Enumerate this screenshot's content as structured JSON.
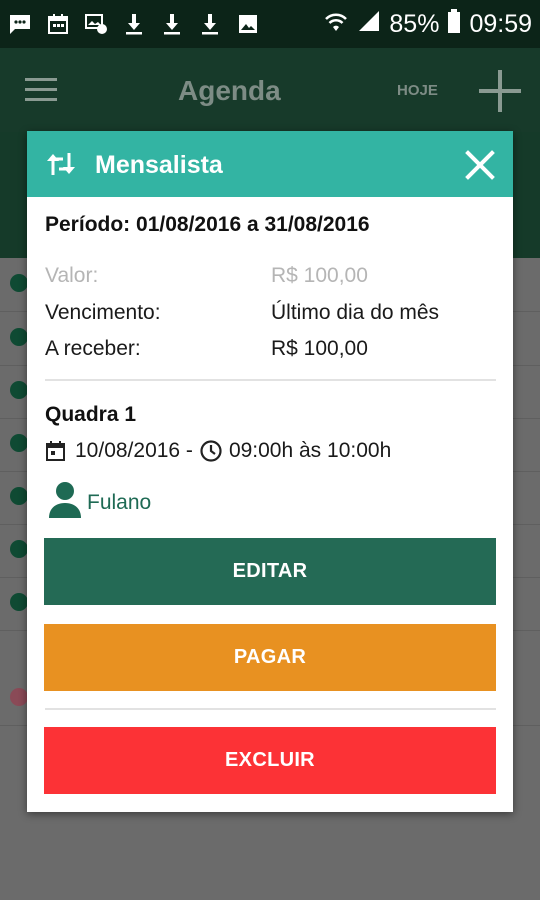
{
  "status_bar": {
    "battery": "85%",
    "time": "09:59",
    "left_icons": [
      "message-icon",
      "calendar-icon",
      "screenshot-icon",
      "download-icon",
      "download-icon",
      "download-icon",
      "image-icon"
    ]
  },
  "app_bar": {
    "title": "Agenda",
    "today_label": "HOJE"
  },
  "dialog": {
    "title": "Mensalista",
    "period_label": "Período:",
    "period_value": "01/08/2016 a 31/08/2016",
    "valor_label": "Valor:",
    "valor_value": "R$ 100,00",
    "vencimento_label": "Vencimento:",
    "vencimento_value": "Último dia do mês",
    "receber_label": "A receber:",
    "receber_value": "R$ 100,00",
    "court": "Quadra 1",
    "date": "10/08/2016 -",
    "time_range": "09:00h às 10:00h",
    "user": "Fulano",
    "edit_button": "EDITAR",
    "pay_button": "PAGAR",
    "delete_button": "EXCLUIR"
  },
  "colors": {
    "header": "#33b4a3",
    "edit": "#246a55",
    "pay": "#e89121",
    "delete": "#fc3236",
    "user": "#1e6a54"
  }
}
